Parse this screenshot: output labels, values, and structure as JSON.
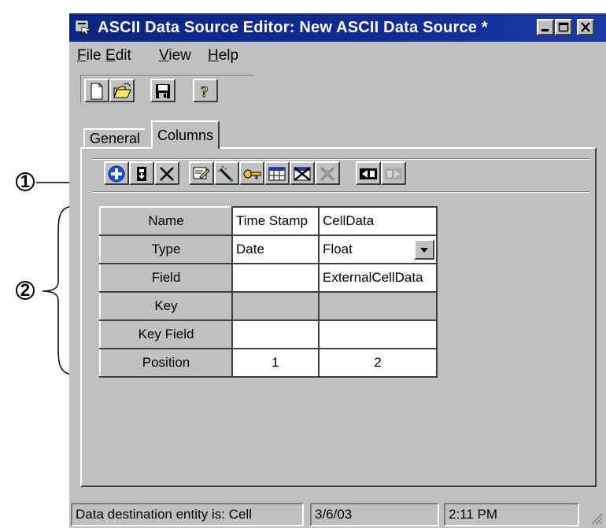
{
  "window": {
    "title": "ASCII Data Source Editor: New ASCII Data Source *"
  },
  "menu": [
    "File",
    "Edit",
    "View",
    "Help"
  ],
  "tabs": [
    "General",
    "Columns"
  ],
  "active_tab": "Columns",
  "grid": {
    "rows": [
      {
        "label": "Name",
        "col1": "Time Stamp",
        "col2": "CellData"
      },
      {
        "label": "Type",
        "col1": "Date",
        "col2": "Float"
      },
      {
        "label": "Field",
        "col1": "",
        "col2": "ExternalCellData"
      },
      {
        "label": "Key",
        "col1": "",
        "col2": ""
      },
      {
        "label": "Key Field",
        "col1": "",
        "col2": ""
      },
      {
        "label": "Position",
        "col1": "1",
        "col2": "2"
      }
    ]
  },
  "status": {
    "message": "Data destination entity is: Cell",
    "date": "3/6/03",
    "time": "2:11 PM"
  },
  "callouts": [
    "1",
    "2"
  ],
  "colors": {
    "title_bar": "#0b2580",
    "face": "#c0c0c0",
    "add_button": "#1d4fd8"
  },
  "icons": {
    "toolbar": [
      "new-file-icon",
      "open-folder-icon",
      "save-icon",
      "help-icon"
    ],
    "columns_toolbar": [
      "add-column-icon",
      "insert-column-icon",
      "delete-column-icon",
      "edit-column-icon",
      "wand-icon",
      "key-icon",
      "table-icon",
      "remove-table-icon",
      "disabled-icon",
      "move-left-icon",
      "move-right-icon"
    ]
  }
}
